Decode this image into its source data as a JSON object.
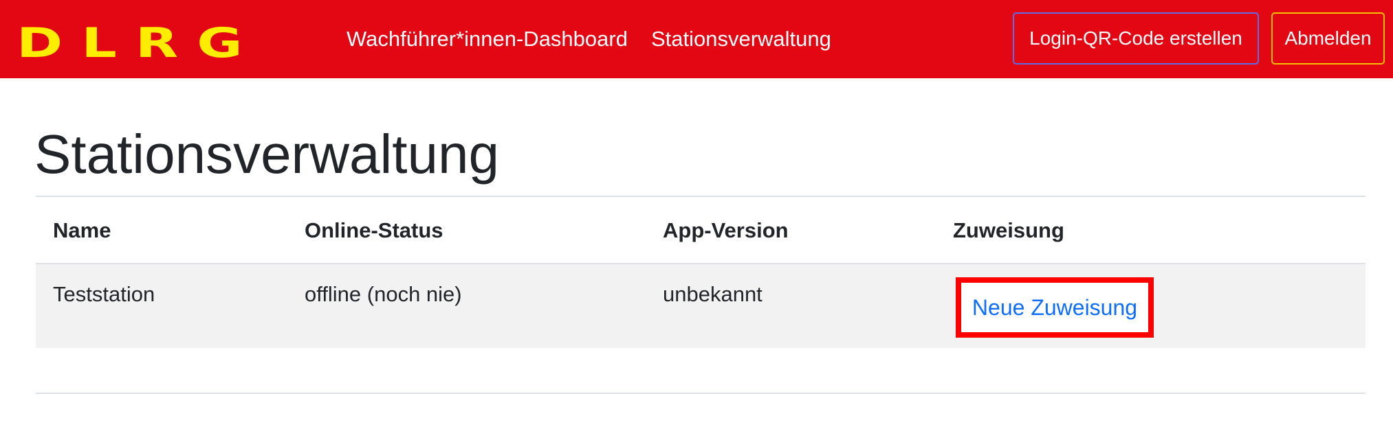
{
  "navbar": {
    "brand": "DLRG",
    "links": [
      "Wachführer*innen-Dashboard",
      "Stationsverwaltung"
    ],
    "qr_button": "Login-QR-Code erstellen",
    "logout_button": "Abmelden",
    "colors": {
      "background": "#e30613",
      "brand": "#ffed00"
    }
  },
  "page": {
    "title": "Stationsverwaltung"
  },
  "table": {
    "headers": {
      "name": "Name",
      "status": "Online-Status",
      "version": "App-Version",
      "assignment": "Zuweisung"
    },
    "rows": [
      {
        "name": "Teststation",
        "status": "offline (noch nie)",
        "version": "unbekannt",
        "assignment_link": "Neue Zuweisung"
      }
    ]
  }
}
